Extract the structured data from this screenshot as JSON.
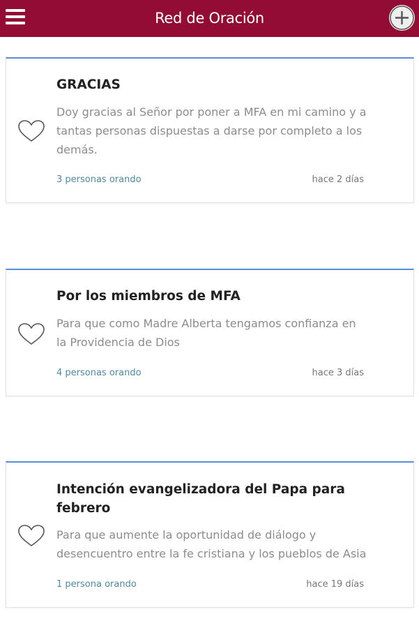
{
  "header": {
    "title": "Red de Oración"
  },
  "colors": {
    "header_bg": "#930c36",
    "card_accent": "#5a8fd6",
    "count_text": "#4a8aa6"
  },
  "icons": {
    "menu": "hamburger-menu-icon",
    "add": "plus-circle-icon",
    "pray": "heart-outline-icon"
  },
  "cards": [
    {
      "title": "GRACIAS",
      "body": "Doy gracias al Señor por poner a MFA en mi camino y a tantas personas dispuestas a darse por completo a los demás.",
      "count": "3 personas orando",
      "time": "hace 2 días"
    },
    {
      "title": "Por los miembros de MFA",
      "body": "Para que como Madre Alberta tengamos confianza en la Providencia de Dios",
      "count": "4 personas orando",
      "time": "hace 3 días"
    },
    {
      "title": "Intención evangelizadora del Papa para febrero",
      "body": "Para que aumente la oportunidad de diálogo y desencuentro entre la fe cristiana y los pueblos de Asia",
      "count": "1 persona orando",
      "time": "hace 19 días"
    }
  ]
}
